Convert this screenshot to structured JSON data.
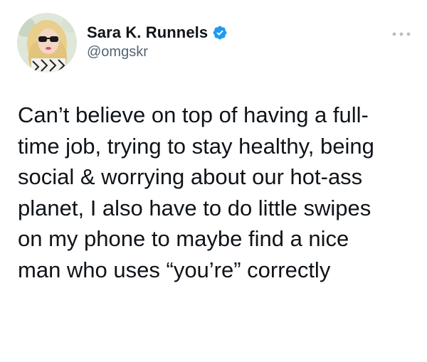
{
  "author": {
    "display_name": "Sara K. Runnels",
    "handle": "@omgskr",
    "verified": true,
    "verified_color": "#1d9bf0"
  },
  "menu_icon": "more-horizontal-icon",
  "tweet": {
    "lines": [
      "Can’t believe on top of having a full-",
      "time job, trying to stay healthy, being",
      "social & worrying about our hot-ass",
      "planet, I also have to do little swipes",
      "on my phone to maybe find a nice",
      "man who uses “you’re” correctly"
    ]
  }
}
